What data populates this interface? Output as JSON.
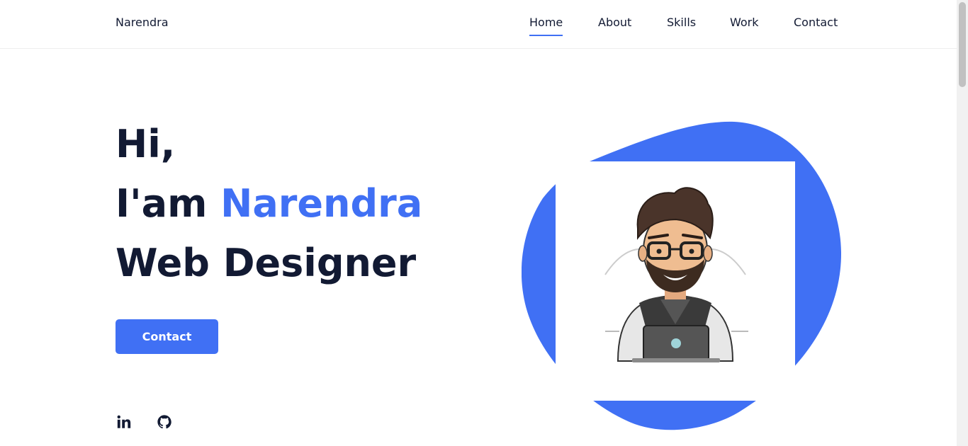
{
  "header": {
    "logo": "Narendra",
    "nav": [
      {
        "label": "Home",
        "active": true
      },
      {
        "label": "About",
        "active": false
      },
      {
        "label": "Skills",
        "active": false
      },
      {
        "label": "Work",
        "active": false
      },
      {
        "label": "Contact",
        "active": false
      }
    ]
  },
  "hero": {
    "greeting": "Hi,",
    "intro_prefix": "I'am ",
    "name": "Narendra",
    "role": "Web Designer",
    "button_label": "Contact"
  },
  "social": [
    {
      "icon": "linkedin-icon"
    },
    {
      "icon": "github-icon"
    }
  ],
  "colors": {
    "accent": "#4070f4",
    "text_dark": "#121a33",
    "background": "#ffffff"
  }
}
